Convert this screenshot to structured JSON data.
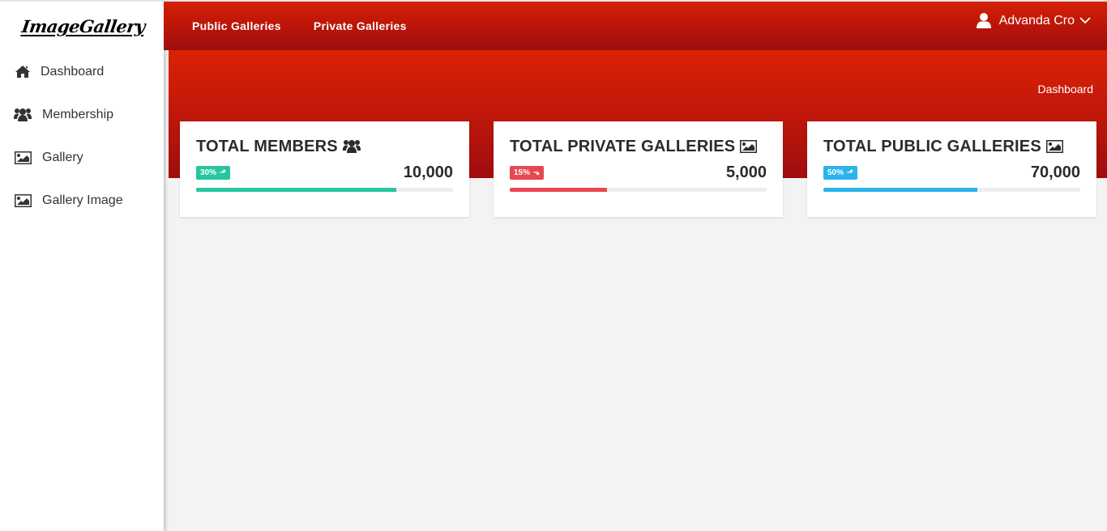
{
  "app": {
    "logo": "ImageGallery"
  },
  "topbar": {
    "links": [
      "Public Galleries",
      "Private Galleries"
    ],
    "user_name": "Advanda Cro"
  },
  "sidebar": {
    "items": [
      {
        "label": "Dashboard",
        "icon": "home-icon"
      },
      {
        "label": "Membership",
        "icon": "users-icon"
      },
      {
        "label": "Gallery",
        "icon": "image-icon"
      },
      {
        "label": "Gallery Image",
        "icon": "image-icon"
      }
    ]
  },
  "breadcrumb": "Dashboard",
  "cards": [
    {
      "title": "TOTAL MEMBERS",
      "icon": "users-icon",
      "badge": "30%",
      "trend": "up",
      "value": "10,000",
      "progress": 0.78,
      "color": "#26c6a0"
    },
    {
      "title": "TOTAL PRIVATE GALLERIES",
      "icon": "image-icon",
      "badge": "15%",
      "trend": "down",
      "value": "5,000",
      "progress": 0.38,
      "color": "#e9474f"
    },
    {
      "title": "TOTAL PUBLIC GALLERIES",
      "icon": "image-icon",
      "badge": "50%",
      "trend": "up",
      "value": "70,000",
      "progress": 0.6,
      "color": "#2bb3ec"
    }
  ]
}
